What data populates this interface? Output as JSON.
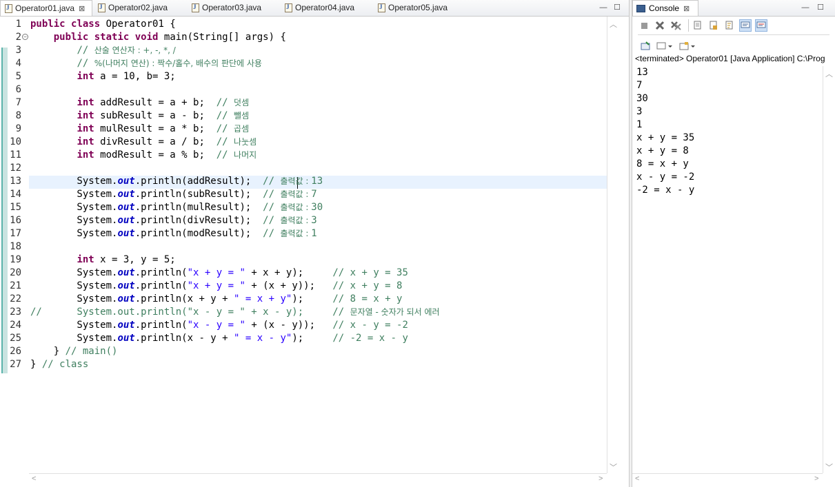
{
  "editor": {
    "tabs": [
      {
        "label": "Operator01.java",
        "active": true
      },
      {
        "label": "Operator02.java",
        "active": false
      },
      {
        "label": "Operator03.java",
        "active": false
      },
      {
        "label": "Operator04.java",
        "active": false
      },
      {
        "label": "Operator05.java",
        "active": false
      }
    ],
    "close_glyph": "⊠",
    "minimize_glyph": "—",
    "maximize_glyph": "☐",
    "current_line": 13,
    "lines": [
      {
        "n": "1",
        "tokens": [
          [
            "kw",
            "public"
          ],
          [
            "t",
            " "
          ],
          [
            "kw",
            "class"
          ],
          [
            "t",
            " Operator01 {"
          ]
        ]
      },
      {
        "n": "2",
        "fold": true,
        "tokens": [
          [
            "t",
            "    "
          ],
          [
            "kw",
            "public"
          ],
          [
            "t",
            " "
          ],
          [
            "kw",
            "static"
          ],
          [
            "t",
            " "
          ],
          [
            "kw",
            "void"
          ],
          [
            "t",
            " main(String[] args) {"
          ]
        ]
      },
      {
        "n": "3",
        "tokens": [
          [
            "t",
            "        "
          ],
          [
            "cm",
            "// "
          ],
          [
            "cmk",
            "산술 연산자 : +, -, *, /"
          ]
        ]
      },
      {
        "n": "4",
        "tokens": [
          [
            "t",
            "        "
          ],
          [
            "cm",
            "// "
          ],
          [
            "cmk",
            "%(나머지 연산) : 짝수/홀수, 배수의 판단에 사용"
          ]
        ]
      },
      {
        "n": "5",
        "tokens": [
          [
            "t",
            "        "
          ],
          [
            "kw",
            "int"
          ],
          [
            "t",
            " a = 10, b= 3;"
          ]
        ]
      },
      {
        "n": "6",
        "tokens": []
      },
      {
        "n": "7",
        "tokens": [
          [
            "t",
            "        "
          ],
          [
            "kw",
            "int"
          ],
          [
            "t",
            " addResult = a + b;  "
          ],
          [
            "cm",
            "// "
          ],
          [
            "cmk",
            "덧셈"
          ]
        ]
      },
      {
        "n": "8",
        "tokens": [
          [
            "t",
            "        "
          ],
          [
            "kw",
            "int"
          ],
          [
            "t",
            " subResult = a - b;  "
          ],
          [
            "cm",
            "// "
          ],
          [
            "cmk",
            "뺄셈"
          ]
        ]
      },
      {
        "n": "9",
        "tokens": [
          [
            "t",
            "        "
          ],
          [
            "kw",
            "int"
          ],
          [
            "t",
            " mulResult = a * b;  "
          ],
          [
            "cm",
            "// "
          ],
          [
            "cmk",
            "곱셈"
          ]
        ]
      },
      {
        "n": "10",
        "tokens": [
          [
            "t",
            "        "
          ],
          [
            "kw",
            "int"
          ],
          [
            "t",
            " divResult = a / b;  "
          ],
          [
            "cm",
            "// "
          ],
          [
            "cmk",
            "나눗셈"
          ]
        ]
      },
      {
        "n": "11",
        "tokens": [
          [
            "t",
            "        "
          ],
          [
            "kw",
            "int"
          ],
          [
            "t",
            " modResult = a % b;  "
          ],
          [
            "cm",
            "// "
          ],
          [
            "cmk",
            "나머지"
          ]
        ]
      },
      {
        "n": "12",
        "tokens": []
      },
      {
        "n": "13",
        "tokens": [
          [
            "t",
            "        System."
          ],
          [
            "fld",
            "out"
          ],
          [
            "t",
            ".println(addResult);  "
          ],
          [
            "cm",
            "// "
          ],
          [
            "cmk",
            "출력값 : "
          ],
          [
            "cm",
            "13"
          ]
        ]
      },
      {
        "n": "14",
        "tokens": [
          [
            "t",
            "        System."
          ],
          [
            "fld",
            "out"
          ],
          [
            "t",
            ".println(subResult);  "
          ],
          [
            "cm",
            "// "
          ],
          [
            "cmk",
            "출력값 : "
          ],
          [
            "cm",
            "7"
          ]
        ]
      },
      {
        "n": "15",
        "tokens": [
          [
            "t",
            "        System."
          ],
          [
            "fld",
            "out"
          ],
          [
            "t",
            ".println(mulResult);  "
          ],
          [
            "cm",
            "// "
          ],
          [
            "cmk",
            "출력값 : "
          ],
          [
            "cm",
            "30"
          ]
        ]
      },
      {
        "n": "16",
        "tokens": [
          [
            "t",
            "        System."
          ],
          [
            "fld",
            "out"
          ],
          [
            "t",
            ".println(divResult);  "
          ],
          [
            "cm",
            "// "
          ],
          [
            "cmk",
            "출력값 : "
          ],
          [
            "cm",
            "3"
          ]
        ]
      },
      {
        "n": "17",
        "tokens": [
          [
            "t",
            "        System."
          ],
          [
            "fld",
            "out"
          ],
          [
            "t",
            ".println(modResult);  "
          ],
          [
            "cm",
            "// "
          ],
          [
            "cmk",
            "출력값 : "
          ],
          [
            "cm",
            "1"
          ]
        ]
      },
      {
        "n": "18",
        "tokens": []
      },
      {
        "n": "19",
        "tokens": [
          [
            "t",
            "        "
          ],
          [
            "kw",
            "int"
          ],
          [
            "t",
            " x = 3, y = 5;"
          ]
        ]
      },
      {
        "n": "20",
        "tokens": [
          [
            "t",
            "        System."
          ],
          [
            "fld",
            "out"
          ],
          [
            "t",
            ".println("
          ],
          [
            "str",
            "\"x + y = \""
          ],
          [
            "t",
            " + x + y);     "
          ],
          [
            "cm",
            "// x + y = 35"
          ]
        ]
      },
      {
        "n": "21",
        "tokens": [
          [
            "t",
            "        System."
          ],
          [
            "fld",
            "out"
          ],
          [
            "t",
            ".println("
          ],
          [
            "str",
            "\"x + y = \""
          ],
          [
            "t",
            " + (x + y));   "
          ],
          [
            "cm",
            "// x + y = 8"
          ]
        ]
      },
      {
        "n": "22",
        "tokens": [
          [
            "t",
            "        System."
          ],
          [
            "fld",
            "out"
          ],
          [
            "t",
            ".println(x + y + "
          ],
          [
            "str",
            "\" = x + y\""
          ],
          [
            "t",
            ");     "
          ],
          [
            "cm",
            "// 8 = x + y"
          ]
        ]
      },
      {
        "n": "23",
        "tokens": [
          [
            "cm",
            "//      System.out.println(\"x - y = \" + x - y);     // "
          ],
          [
            "cmk",
            "문자열 - 숫자가 되서 에러"
          ]
        ]
      },
      {
        "n": "24",
        "tokens": [
          [
            "t",
            "        System."
          ],
          [
            "fld",
            "out"
          ],
          [
            "t",
            ".println("
          ],
          [
            "str",
            "\"x - y = \""
          ],
          [
            "t",
            " + (x - y));   "
          ],
          [
            "cm",
            "// x - y = -2"
          ]
        ]
      },
      {
        "n": "25",
        "tokens": [
          [
            "t",
            "        System."
          ],
          [
            "fld",
            "out"
          ],
          [
            "t",
            ".println(x - y + "
          ],
          [
            "str",
            "\" = x - y\""
          ],
          [
            "t",
            ");     "
          ],
          [
            "cm",
            "// -2 = x - y"
          ]
        ]
      },
      {
        "n": "26",
        "tokens": [
          [
            "t",
            "    } "
          ],
          [
            "cm",
            "// main()"
          ]
        ]
      },
      {
        "n": "27",
        "tokens": [
          [
            "t",
            "} "
          ],
          [
            "cm",
            "// class"
          ]
        ]
      }
    ]
  },
  "console": {
    "tab_label": "Console",
    "close_glyph": "⊠",
    "minimize_glyph": "—",
    "maximize_glyph": "☐",
    "toolbar1": [
      "terminate-icon",
      "remove-launch-icon",
      "remove-all-icon",
      "clear-console-icon",
      "scroll-lock-icon",
      "word-wrap-icon",
      "show-on-stdout-icon",
      "show-on-stderr-icon"
    ],
    "toolbar2": [
      "pin-console-icon",
      "display-console-icon",
      "open-console-icon"
    ],
    "status": "<terminated> Operator01 [Java Application] C:\\Prog",
    "output": [
      "13",
      "7",
      "30",
      "3",
      "1",
      "x + y = 35",
      "x + y = 8",
      "8 = x + y",
      "x - y = -2",
      "-2 = x - y"
    ]
  }
}
